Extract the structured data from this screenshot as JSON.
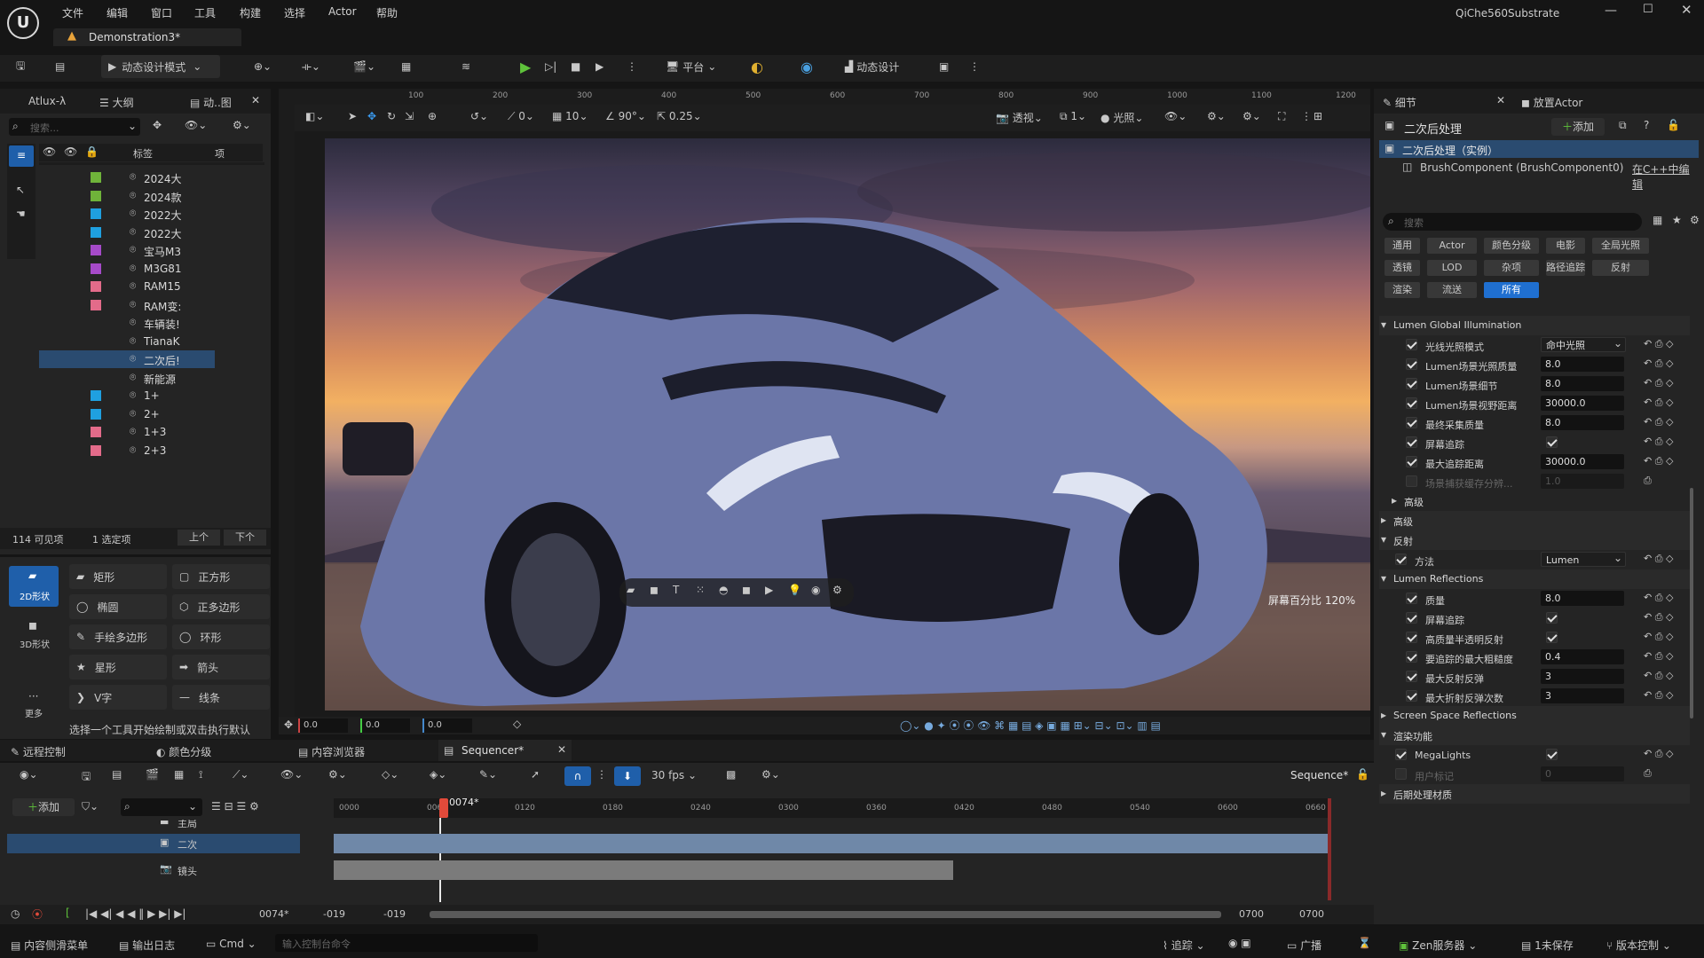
{
  "app": {
    "project": "QiChe560Substrate",
    "level": "Demonstration3*"
  },
  "menu": [
    "文件",
    "编辑",
    "窗口",
    "工具",
    "构建",
    "选择",
    "Actor",
    "帮助"
  ],
  "toolbar": {
    "mode": "动态设计模式",
    "platform": "平台",
    "dyn": "动态设计"
  },
  "outliner": {
    "tabs": [
      "Atlux-λ",
      "大纲",
      "动..图"
    ],
    "search": "搜索...",
    "col_label": "标签",
    "col_type": "项",
    "rows": [
      {
        "label": "2024大",
        "color": "#6fb33a"
      },
      {
        "label": "2024款",
        "color": "#6fb33a"
      },
      {
        "label": "2022大",
        "color": "#1fa0e0"
      },
      {
        "label": "2022大",
        "color": "#1fa0e0"
      },
      {
        "label": "宝马M3",
        "color": "#a64ac9"
      },
      {
        "label": "M3G81",
        "color": "#a64ac9"
      },
      {
        "label": "RAM15",
        "color": "#e36b8a"
      },
      {
        "label": "RAM变:",
        "color": "#e36b8a"
      },
      {
        "label": "车辆装!",
        "color": ""
      },
      {
        "label": "TianaK",
        "color": ""
      },
      {
        "label": "二次后!",
        "color": ""
      },
      {
        "label": "新能源",
        "color": ""
      },
      {
        "label": "1+",
        "color": "#1fa0e0"
      },
      {
        "label": "2+",
        "color": "#1fa0e0"
      },
      {
        "label": "1+3",
        "color": "#e36b8a"
      },
      {
        "label": "2+3",
        "color": "#e36b8a"
      }
    ],
    "visible": "114 可见项",
    "selected": "1 选定项",
    "up": "上个",
    "down": "下个"
  },
  "shapes": {
    "mode2d": "2D形状",
    "mode3d": "3D形状",
    "more": "更多",
    "items": [
      "矩形",
      "正方形",
      "椭圆",
      "正多边形",
      "手绘多边形",
      "环形",
      "星形",
      "箭头",
      "V字",
      "线条"
    ],
    "hint": "选择一个工具开始绘制或双击执行默认"
  },
  "viewport": {
    "perspective": "透视",
    "lit": "光照",
    "screen_pct_label": "屏幕百分比",
    "screen_pct": "120%",
    "snap1": "0",
    "snap2": "10",
    "snap3": "90°",
    "snap4": "0.25",
    "coords": [
      "0.0",
      "0.0",
      "0.0"
    ],
    "layers": "1",
    "ruler": [
      "100",
      "200",
      "300",
      "400",
      "500",
      "600",
      "700",
      "800",
      "900",
      "1000",
      "1100",
      "1200"
    ]
  },
  "details": {
    "tab1": "细节",
    "tab2": "放置Actor",
    "title": "二次后处理",
    "add": "添加",
    "instance": "二次后处理（实例）",
    "component": "BrushComponent (BrushComponent0)",
    "edit_cpp": "在C++中编辑",
    "search": "搜索",
    "filters": [
      [
        "通用",
        "Actor",
        "颜色分级",
        "电影",
        "全局光照"
      ],
      [
        "透镜",
        "LOD",
        "杂项",
        "路径追踪",
        "反射"
      ],
      [
        "渲染",
        "流送",
        "所有"
      ]
    ],
    "sections": [
      {
        "type": "section",
        "label": "Lumen Global Illumination"
      },
      {
        "type": "prop",
        "label": "光线光照模式",
        "value": "命中光照",
        "dropdown": true
      },
      {
        "type": "prop",
        "label": "Lumen场景光照质量",
        "value": "8.0"
      },
      {
        "type": "prop",
        "label": "Lumen场景细节",
        "value": "8.0"
      },
      {
        "type": "prop",
        "label": "Lumen场景视野距离",
        "value": "30000.0"
      },
      {
        "type": "prop",
        "label": "最终采集质量",
        "value": "8.0"
      },
      {
        "type": "prop",
        "label": "屏幕追踪",
        "value": "",
        "check": true
      },
      {
        "type": "prop",
        "label": "最大追踪距离",
        "value": "30000.0"
      },
      {
        "type": "prop",
        "label": "场景捕获缓存分辨...",
        "value": "1.0",
        "disabled": true
      },
      {
        "type": "sub",
        "label": "高级"
      },
      {
        "type": "section",
        "label": "高级",
        "collapsed": true
      },
      {
        "type": "section",
        "label": "反射"
      },
      {
        "type": "prop2",
        "label": "方法",
        "value": "Lumen",
        "dropdown": true
      },
      {
        "type": "section",
        "label": "Lumen Reflections"
      },
      {
        "type": "prop",
        "label": "质量",
        "value": "8.0"
      },
      {
        "type": "prop",
        "label": "屏幕追踪",
        "value": "",
        "check": true
      },
      {
        "type": "prop",
        "label": "高质量半透明反射",
        "value": "",
        "check": true
      },
      {
        "type": "prop",
        "label": "要追踪的最大粗糙度",
        "value": "0.4"
      },
      {
        "type": "prop",
        "label": "最大反射反弹",
        "value": "3"
      },
      {
        "type": "prop",
        "label": "最大折射反弹次数",
        "value": "3"
      },
      {
        "type": "section",
        "label": "Screen Space Reflections",
        "collapsed": true
      },
      {
        "type": "section",
        "label": "渲染功能"
      },
      {
        "type": "prop2",
        "label": "MegaLights",
        "value": "",
        "check": true
      },
      {
        "type": "prop2",
        "label": "用户标记",
        "value": "0",
        "disabled": true
      },
      {
        "type": "section",
        "label": "后期处理材质",
        "collapsed": true
      }
    ]
  },
  "bottom_tabs": [
    "远程控制",
    "颜色分级",
    "内容浏览器",
    "Sequencer*"
  ],
  "sequencer": {
    "fps": "30 fps",
    "name": "Sequence*",
    "add": "添加",
    "current": "0074*",
    "frame_field": "0074*",
    "ticks": [
      "0000",
      "0060",
      "0120",
      "0180",
      "0240",
      "0300",
      "0360",
      "0420",
      "0480",
      "0540",
      "0600",
      "0660"
    ],
    "tracks": [
      "主局",
      "二次",
      "镜头"
    ],
    "start": "-019",
    "start2": "-019",
    "end": "0700",
    "end2": "0700"
  },
  "statusbar": {
    "drawer": "内容侧滑菜单",
    "log": "输出日志",
    "cmd": "Cmd",
    "cmd_placeholder": "输入控制台命令",
    "trace": "追踪",
    "broadcast": "广播",
    "zen": "Zen服务器",
    "unsaved": "1未保存",
    "vcs": "版本控制"
  }
}
